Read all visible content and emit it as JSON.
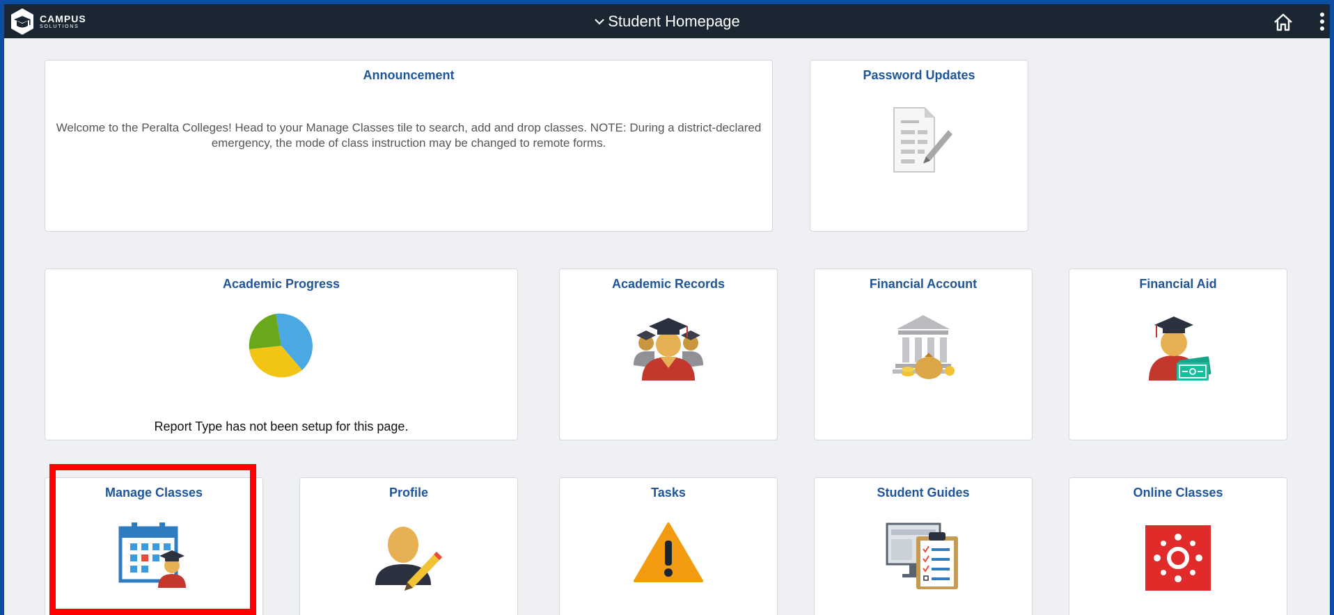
{
  "header": {
    "logo_line1": "CAMPUS",
    "logo_line2": "SOLUTIONS",
    "title": "Student Homepage",
    "title_icon": "chevron-down-icon",
    "home_icon": "home-icon",
    "more_icon": "vertical-ellipsis-icon"
  },
  "tiles": {
    "announcement": {
      "title": "Announcement",
      "text": "Welcome to the Peralta Colleges! Head to your Manage Classes tile to search, add and drop classes. NOTE: During a district-declared emergency, the mode of class instruction may be changed to remote forms."
    },
    "password_updates": {
      "title": "Password Updates",
      "icon": "document-pencil-icon"
    },
    "academic_progress": {
      "title": "Academic Progress",
      "icon": "pie-chart-icon",
      "note": "Report Type has not been setup for this page."
    },
    "academic_records": {
      "title": "Academic Records",
      "icon": "graduates-icon"
    },
    "financial_account": {
      "title": "Financial Account",
      "icon": "bank-icon"
    },
    "financial_aid": {
      "title": "Financial Aid",
      "icon": "graduate-money-icon"
    },
    "manage_classes": {
      "title": "Manage Classes",
      "icon": "calendar-student-icon"
    },
    "profile": {
      "title": "Profile",
      "icon": "user-edit-icon"
    },
    "tasks": {
      "title": "Tasks",
      "icon": "warning-icon"
    },
    "student_guides": {
      "title": "Student Guides",
      "icon": "clipboard-checklist-icon"
    },
    "online_classes": {
      "title": "Online Classes",
      "icon": "canvas-logo-icon"
    }
  },
  "colors": {
    "header_bg": "#1a2733",
    "tile_title": "#1f5596",
    "page_bg": "#eef0f4",
    "highlight": "#ff0000"
  }
}
